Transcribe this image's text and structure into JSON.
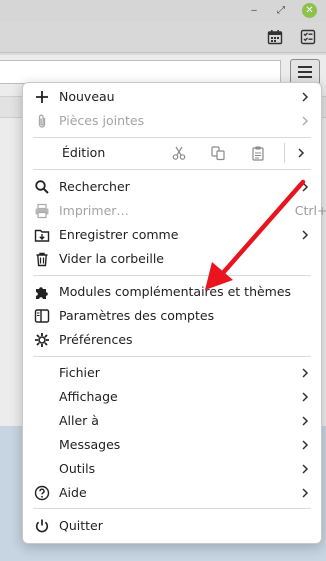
{
  "window": {
    "controls": {
      "minimize": "‒",
      "maximize": "⤢",
      "close": "✕"
    },
    "toolbar_icons": [
      "calendar-icon",
      "tasks-icon"
    ]
  },
  "menu": {
    "items": [
      {
        "label": "Nouveau",
        "icon": "plus-icon",
        "submenu": true,
        "enabled": true
      },
      {
        "label": "Pièces jointes",
        "icon": "paperclip-icon",
        "submenu": true,
        "enabled": false
      },
      {
        "label": "Édition",
        "icons": [
          "cut-icon",
          "copy-icon",
          "paste-icon"
        ],
        "submenu": true
      },
      {
        "label": "Rechercher",
        "icon": "search-icon",
        "submenu": true,
        "enabled": true
      },
      {
        "label": "Imprimer…",
        "icon": "printer-icon",
        "shortcut": "Ctrl+P",
        "enabled": false
      },
      {
        "label": "Enregistrer comme",
        "icon": "save-icon",
        "submenu": true,
        "enabled": true
      },
      {
        "label": "Vider la corbeille",
        "icon": "trash-icon",
        "enabled": true
      },
      {
        "label": "Modules complémentaires et thèmes",
        "icon": "puzzle-icon",
        "enabled": true
      },
      {
        "label": "Paramètres des comptes",
        "icon": "account-settings-icon",
        "enabled": true
      },
      {
        "label": "Préférences",
        "icon": "gear-icon",
        "enabled": true
      },
      {
        "label": "Fichier",
        "submenu": true
      },
      {
        "label": "Affichage",
        "submenu": true
      },
      {
        "label": "Aller à",
        "submenu": true
      },
      {
        "label": "Messages",
        "submenu": true
      },
      {
        "label": "Outils",
        "submenu": true
      },
      {
        "label": "Aide",
        "icon": "help-icon",
        "submenu": true
      },
      {
        "label": "Quitter",
        "icon": "power-icon",
        "enabled": true
      }
    ]
  },
  "annotation": {
    "color": "#e8141e",
    "type": "arrow",
    "points_to": "Modules complémentaires et thèmes"
  }
}
